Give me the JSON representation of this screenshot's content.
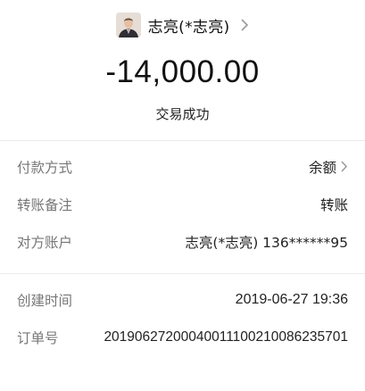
{
  "header": {
    "counterparty_name": "志亮(*志亮)",
    "amount": "-14,000.00",
    "status": "交易成功"
  },
  "details": {
    "payment_method": {
      "label": "付款方式",
      "value": "余额"
    },
    "transfer_note": {
      "label": "转账备注",
      "value": "转账"
    },
    "counterparty_account": {
      "label": "对方账户",
      "value": "志亮(*志亮) 136******95"
    }
  },
  "meta": {
    "created_time": {
      "label": "创建时间",
      "value": "2019-06-27 19:36"
    },
    "order_number": {
      "label": "订单号",
      "value": "2019062720004001110021008623570​1"
    }
  },
  "icons": {
    "avatar": "avatar-photo",
    "counterparty_chevron": "chevron-right-icon",
    "payment_chevron": "chevron-right-icon"
  }
}
